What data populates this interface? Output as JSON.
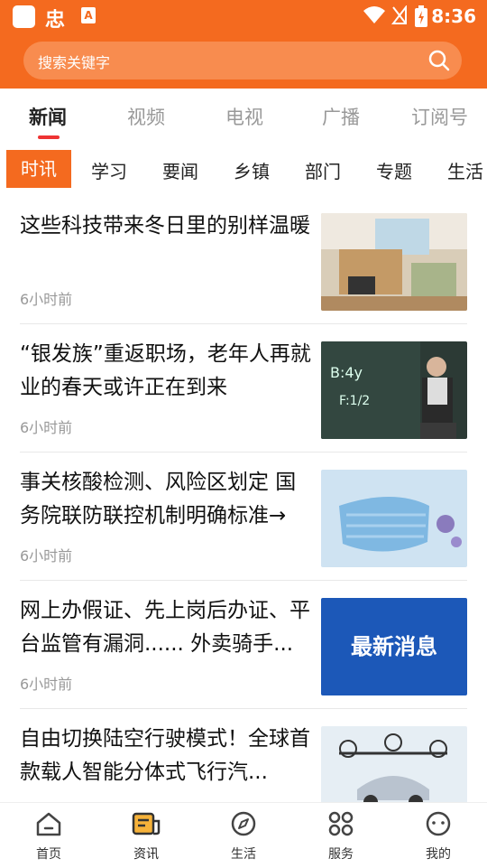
{
  "status": {
    "time": "8:36",
    "app_letter": "A",
    "app_glyph": "忠"
  },
  "search": {
    "placeholder": "搜索关键字"
  },
  "tabs": [
    {
      "label": "新闻",
      "active": true
    },
    {
      "label": "视频"
    },
    {
      "label": "电视"
    },
    {
      "label": "广播"
    },
    {
      "label": "订阅号"
    }
  ],
  "categories": [
    {
      "label": "时讯",
      "active": true
    },
    {
      "label": "学习"
    },
    {
      "label": "要闻"
    },
    {
      "label": "乡镇"
    },
    {
      "label": "部门"
    },
    {
      "label": "专题"
    },
    {
      "label": "生活"
    }
  ],
  "news": [
    {
      "title": "这些科技带来冬日里的别样温暖",
      "time": "6小时前",
      "thumb": "room-interior"
    },
    {
      "title": "“银发族”重返职场，老年人再就业的春天或许正在到来",
      "time": "6小时前",
      "thumb": "teacher-blackboard"
    },
    {
      "title": "事关核酸检测、风险区划定 国务院联防联控机制明确标准→",
      "time": "6小时前",
      "thumb": "face-mask"
    },
    {
      "title": "网上办假证、先上岗后办证、平台监管有漏洞...... 外卖骑手...",
      "time": "6小时前",
      "thumb": "latest-news-banner",
      "thumb_text": "最新消息"
    },
    {
      "title": "自由切换陆空行驶模式！全球首款载人智能分体式飞行汽...",
      "time": "",
      "thumb": "flying-car"
    }
  ],
  "bottom_nav": [
    {
      "label": "首页",
      "icon": "home-icon"
    },
    {
      "label": "资讯",
      "icon": "news-icon",
      "active": true
    },
    {
      "label": "生活",
      "icon": "compass-icon"
    },
    {
      "label": "服务",
      "icon": "grid-icon"
    },
    {
      "label": "我的",
      "icon": "profile-icon"
    }
  ],
  "colors": {
    "brand": "#f46a1f",
    "accent_red": "#e33333"
  }
}
